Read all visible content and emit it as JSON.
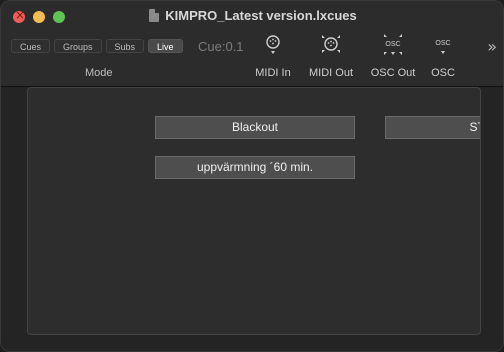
{
  "window": {
    "title": "KIMPRO_Latest version.lxcues"
  },
  "modes": {
    "items": [
      "Cues",
      "Groups",
      "Subs",
      "Live"
    ],
    "caption": "Mode"
  },
  "cue_indicator": "Cue:0.1",
  "toolbar": {
    "midi_in": "MIDI In",
    "midi_out": "MIDI Out",
    "osc_out": "OSC Out",
    "osc": "OSC",
    "osc_icon_text": "OSC",
    "osc_out_icon_text": "OSC"
  },
  "cue_buttons": {
    "blackout": "Blackout",
    "start": "STAR",
    "warmup": "uppvärmning ´60 min."
  },
  "colors": {
    "close": "#ec5f57",
    "minimize": "#f4bd4f",
    "maximize": "#5fc454"
  }
}
